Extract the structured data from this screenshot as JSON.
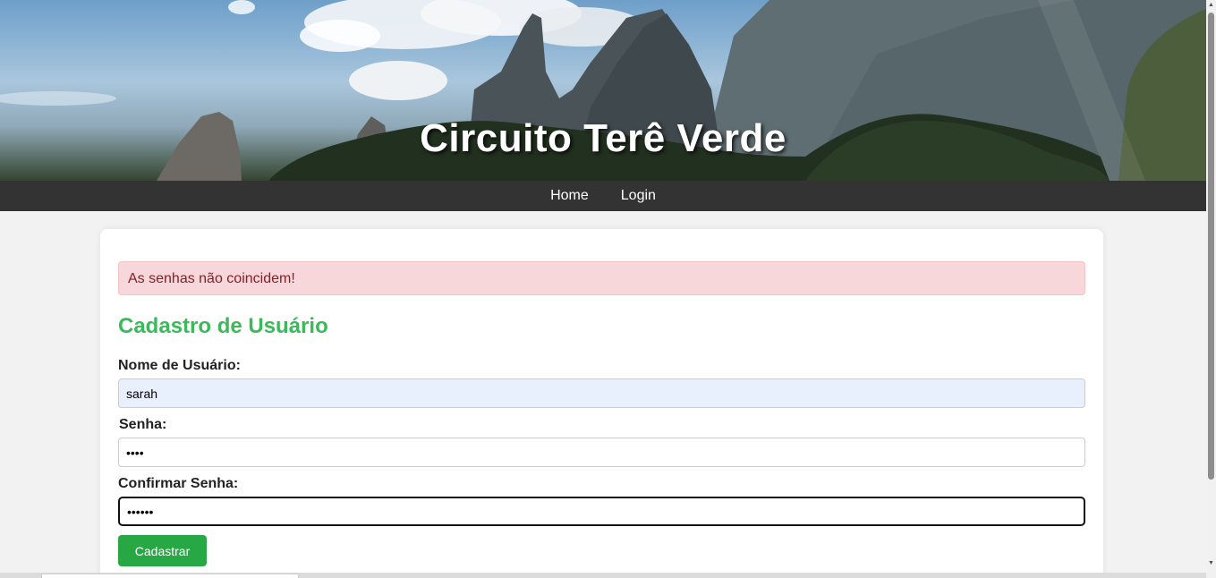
{
  "header": {
    "title": "Circuito Terê Verde"
  },
  "nav": {
    "items": [
      {
        "label": "Home"
      },
      {
        "label": "Login"
      }
    ]
  },
  "alert": {
    "message": "As senhas não coincidem!"
  },
  "form": {
    "title": "Cadastro de Usuário",
    "username_label": "Nome de Usuário:",
    "username_value": "sarah",
    "password_label": "Senha:",
    "password_value": "1234",
    "confirm_label": "Confirmar Senha:",
    "confirm_value": "123456",
    "submit_label": "Cadastrar"
  },
  "colors": {
    "accent_green": "#3cb95a",
    "button_green": "#28a745",
    "nav_bg": "#333333",
    "alert_bg": "#f8d7da",
    "alert_text": "#842029"
  }
}
